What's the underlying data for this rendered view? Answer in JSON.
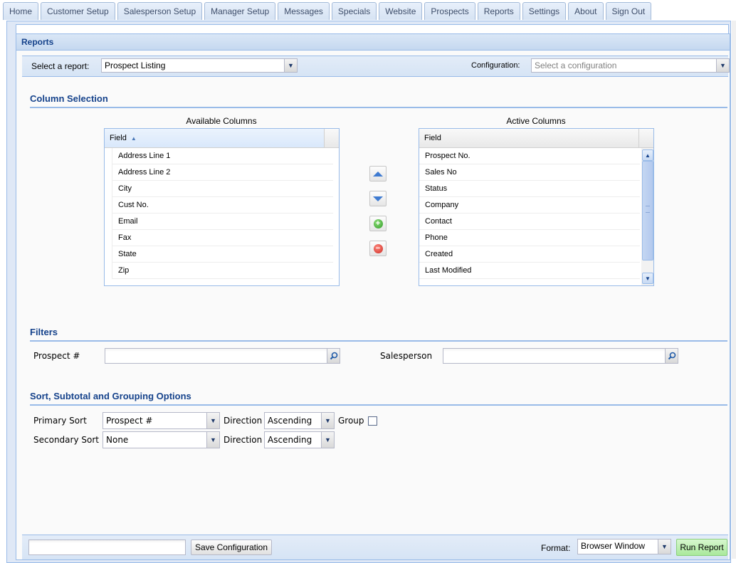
{
  "tabs": [
    {
      "label": "Home"
    },
    {
      "label": "Customer Setup"
    },
    {
      "label": "Salesperson Setup"
    },
    {
      "label": "Manager Setup"
    },
    {
      "label": "Messages"
    },
    {
      "label": "Specials"
    },
    {
      "label": "Website"
    },
    {
      "label": "Prospects"
    },
    {
      "label": "Reports"
    },
    {
      "label": "Settings"
    },
    {
      "label": "About"
    },
    {
      "label": "Sign Out"
    }
  ],
  "panel": {
    "title": "Reports",
    "select_report_label": "Select a report:",
    "report_value": "Prospect Listing",
    "configuration_label": "Configuration:",
    "configuration_placeholder": "Select a configuration"
  },
  "column_selection": {
    "title": "Column Selection",
    "available": {
      "title": "Available Columns",
      "header": "Field",
      "sort": "ascending",
      "rows": [
        "Address Line 1",
        "Address Line 2",
        "City",
        "Cust No.",
        "Email",
        "Fax",
        "State",
        "Zip"
      ]
    },
    "active": {
      "title": "Active Columns",
      "header": "Field",
      "rows": [
        "Prospect No.",
        "Sales No",
        "Status",
        "Company",
        "Contact",
        "Phone",
        "Created",
        "Last Modified"
      ]
    },
    "buttons": {
      "move_up": "move-up",
      "move_down": "move-down",
      "add": "add",
      "remove": "remove"
    }
  },
  "filters": {
    "title": "Filters",
    "prospect_label": "Prospect #",
    "prospect_value": "",
    "salesperson_label": "Salesperson",
    "salesperson_value": ""
  },
  "sort": {
    "title": "Sort, Subtotal and Grouping Options",
    "primary_label": "Primary Sort",
    "primary_value": "Prospect #",
    "primary_direction_label": "Direction",
    "primary_direction_value": "Ascending",
    "group_label": "Group",
    "group_checked": false,
    "secondary_label": "Secondary Sort",
    "secondary_value": "None",
    "secondary_direction_label": "Direction",
    "secondary_direction_value": "Ascending"
  },
  "footer": {
    "config_name_value": "",
    "save_label": "Save Configuration",
    "format_label": "Format:",
    "format_value": "Browser Window",
    "run_label": "Run Report"
  },
  "colors": {
    "accent": "#15428b",
    "border": "#99bbe8",
    "run_button": "#a9e99b"
  }
}
